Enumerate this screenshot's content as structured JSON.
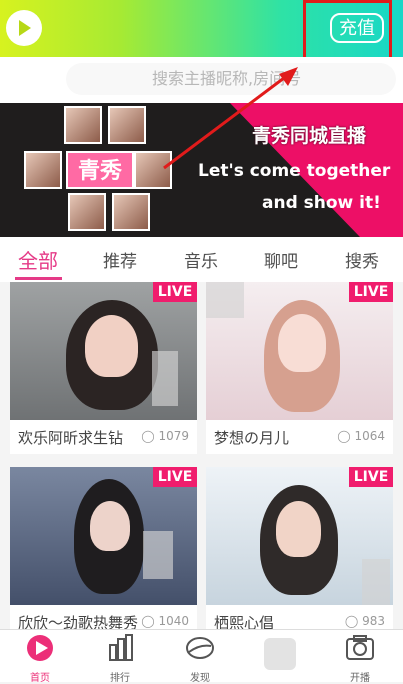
{
  "top_bar": {
    "recharge_label": "充值"
  },
  "search": {
    "placeholder": "搜索主播昵称,房间号"
  },
  "banner": {
    "brand": "青秀",
    "title": "青秀同城直播",
    "line1": "Let's come together",
    "line2": "and show it!"
  },
  "tabs": [
    {
      "label": "全部",
      "active": true
    },
    {
      "label": "推荐"
    },
    {
      "label": "音乐"
    },
    {
      "label": "聊吧"
    },
    {
      "label": "搜秀"
    }
  ],
  "cards": [
    {
      "badge": "LIVE",
      "title": "欢乐阿昕求生钻",
      "viewers": "1079"
    },
    {
      "badge": "LIVE",
      "title": "梦想の月儿",
      "viewers": "1064"
    },
    {
      "badge": "LIVE",
      "title": "欣欣～劲歌热舞秀",
      "viewers": "1040"
    },
    {
      "badge": "LIVE",
      "title": "栖熙心倡",
      "viewers": "983"
    }
  ],
  "bottom_nav": [
    {
      "label": "首页",
      "active": true
    },
    {
      "label": "排行"
    },
    {
      "label": "发现"
    },
    {
      "label": ""
    },
    {
      "label": "开播"
    }
  ]
}
